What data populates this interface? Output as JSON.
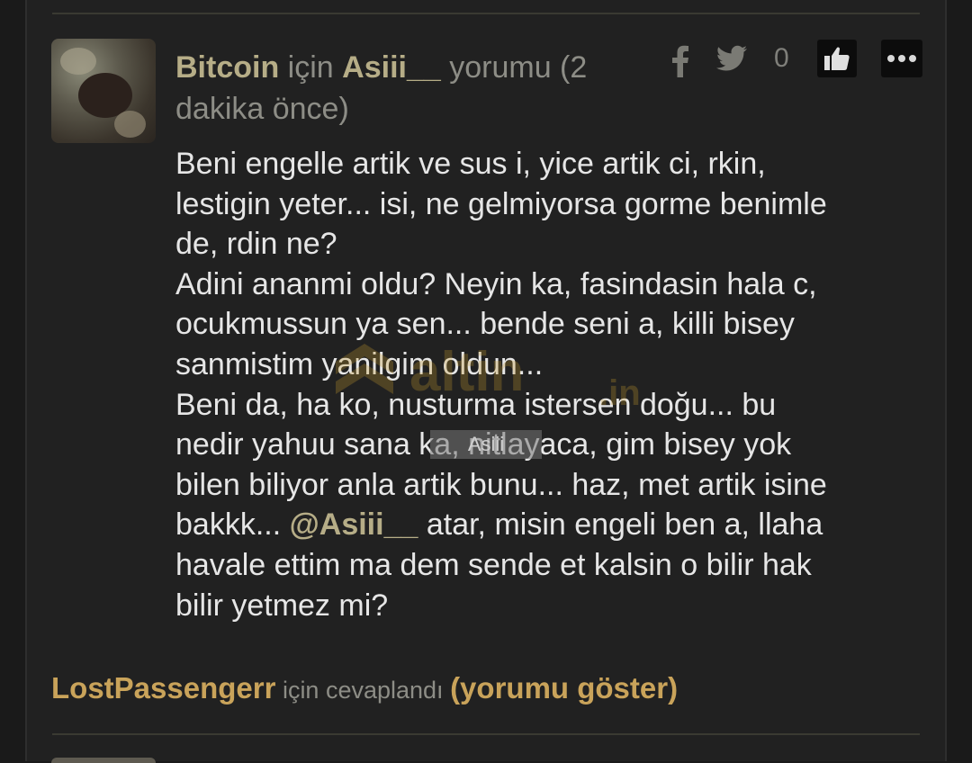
{
  "comment": {
    "author": "Bitcoin",
    "for_word": "için",
    "target": "Asiii__",
    "suffix": "yorumu (2",
    "time_line": "dakika önce)",
    "likes": "0",
    "body_lines": [
      "Beni engelle artik ve sus i, yice artik ci, rkin,",
      "lestigin yeter... isi, ne gelmiyorsa gorme benimle",
      "de, rdin ne?",
      "Adini ananmi oldu? Neyin ka, fasindasin hala c,",
      "ocukmussun ya sen... bende seni a, killi bisey",
      "sanmistim yanilgim oldun...",
      "Beni da, ha ko, nusturma istersen doğu... bu",
      "nedir yahuu sana ka, nitlayaca, gim bisey yok",
      "bilen biliyor anla artik bunu... haz, met artik isine"
    ],
    "mention_line_prefix": "bakkk... ",
    "mention": "@Asiii__",
    "mention_line_suffix": " atar, misin engeli ben a, llaha",
    "tail_lines": [
      "havale ettim ma dem sende et kalsin o bilir hak",
      "bilir yetmez mi?"
    ]
  },
  "watermark": {
    "brand": "altin",
    "tld": ".in",
    "badge": "Asiii"
  },
  "reply": {
    "user": "LostPassengerr",
    "middle": " için cevaplandı ",
    "show_label": "(yorumu göster)"
  },
  "colors": {
    "background": "#212121",
    "author": "#b6ad87",
    "reply_link": "#c9a35a",
    "body_text": "#e6e6e6"
  },
  "icons": [
    "facebook-icon",
    "twitter-icon",
    "thumbs-up-icon",
    "more-dots-icon"
  ]
}
